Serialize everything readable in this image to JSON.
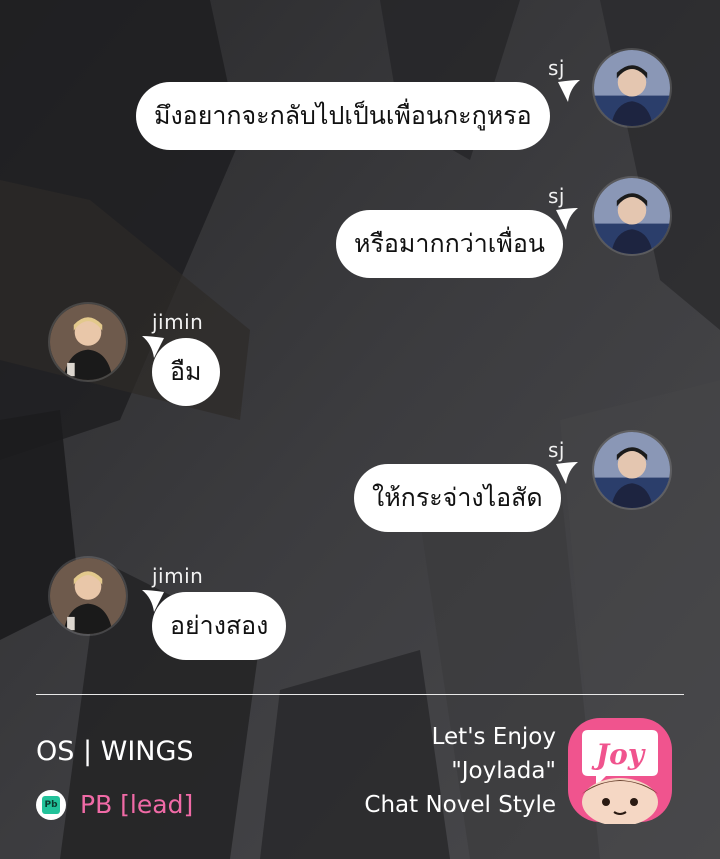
{
  "chat": {
    "messages": [
      {
        "sender": "sj",
        "side": "right",
        "text": "มึงอยากจะกลับไปเป็นเพื่อนกะกูหรอ"
      },
      {
        "sender": "sj",
        "side": "right",
        "text": "หรือมากกว่าเพื่อน"
      },
      {
        "sender": "jimin",
        "side": "left",
        "text": "อืม"
      },
      {
        "sender": "sj",
        "side": "right",
        "text": "ให้กระจ่างไอสัด"
      },
      {
        "sender": "jimin",
        "side": "left",
        "text": "อย่างสอง"
      }
    ],
    "senders": {
      "sj": "sj",
      "jimin": "jimin"
    }
  },
  "footer": {
    "story_title": "OS | WINGS",
    "pb_icon_label": "Pb",
    "author": "PB [lead]",
    "promo_line1": "Let's Enjoy",
    "promo_line2": "\"Joylada\"",
    "promo_line3": "Chat Novel Style",
    "logo_text": "Joy"
  },
  "colors": {
    "bubble": "#ffffff",
    "author": "#f06aa6",
    "logo_bg": "#f0548e",
    "pb_green": "#22c29a"
  },
  "icons": [
    "avatar-sj",
    "avatar-jimin",
    "pb-icon",
    "joylada-logo"
  ]
}
